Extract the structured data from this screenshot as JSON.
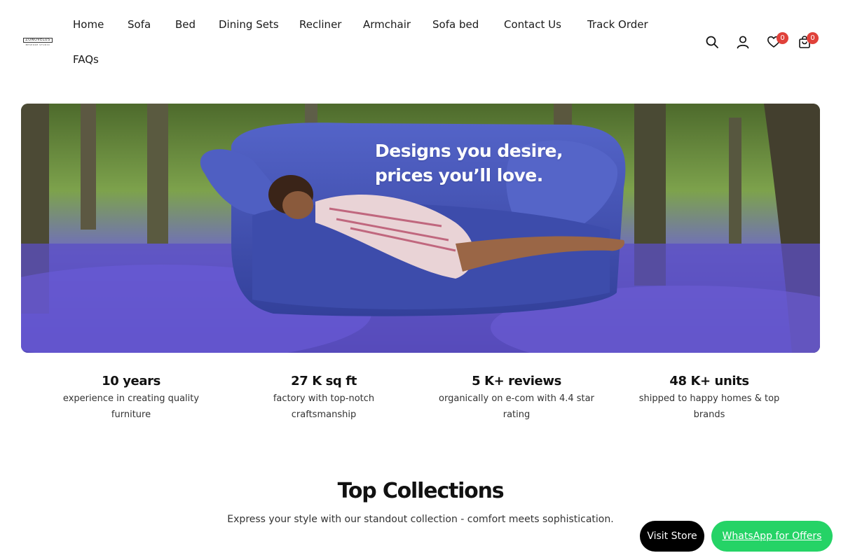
{
  "brand": {
    "logo_text": "ZONOVELUS",
    "logo_sub": "BESPOKE STUDIO"
  },
  "nav": {
    "items": [
      {
        "label": "Home"
      },
      {
        "label": "Sofa"
      },
      {
        "label": "Bed"
      },
      {
        "label": "Dining Sets"
      },
      {
        "label": "Recliner"
      },
      {
        "label": "Armchair"
      },
      {
        "label": "Sofa bed"
      },
      {
        "label": "Contact Us"
      },
      {
        "label": "Track Order"
      },
      {
        "label": "FAQs"
      }
    ]
  },
  "header_icons": {
    "search": {
      "icon": "search-icon"
    },
    "account": {
      "icon": "user-icon"
    },
    "wishlist": {
      "icon": "heart-icon",
      "count": "0"
    },
    "cart": {
      "icon": "shopping-bag-icon",
      "count": "0"
    }
  },
  "hero": {
    "headline_line1": "Designs you desire,",
    "headline_line2": "prices you’ll love."
  },
  "stats": [
    {
      "title": "10 years",
      "desc": "experience in creating quality furniture"
    },
    {
      "title": "27 K sq ft",
      "desc": "factory with top-notch craftsmanship"
    },
    {
      "title": "5 K+ reviews",
      "desc": "organically on e-com with 4.4 star rating"
    },
    {
      "title": "48 K+ units",
      "desc": "shipped to happy homes & top brands"
    }
  ],
  "collections": {
    "title": "Top Collections",
    "subtitle": "Express your style with our standout collection - comfort meets sophistication."
  },
  "floating": {
    "visit_store": "Visit Store",
    "whatsapp": "WhatsApp for Offers"
  },
  "colors": {
    "badge": "#e0413a",
    "visit_store_bg": "#000000",
    "whatsapp_bg": "#25d366",
    "sofa_blue": "#4455b8",
    "bluebell_purple": "#6b5bd6",
    "forest_green": "#5f8a3a"
  }
}
